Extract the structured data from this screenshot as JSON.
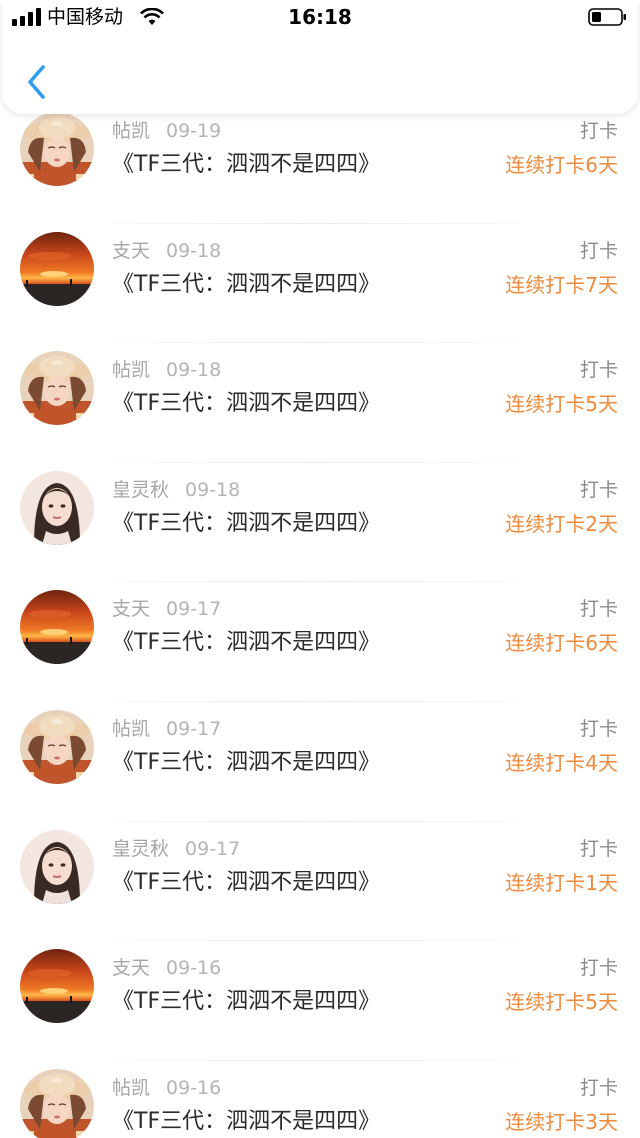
{
  "status_bar": {
    "carrier": "中国移动",
    "time": "16:18"
  },
  "nav": {
    "back_icon": "chevron-left-icon",
    "accent_color": "#2f9df0"
  },
  "colors": {
    "streak": "#f08a3c",
    "meta": "#a6a6a6"
  },
  "items": [
    {
      "user": "帖凯",
      "date": "09-19",
      "book": "《TF三代：泗泗不是四四》",
      "action": "打卡",
      "streak": "连续打卡6天",
      "avatar": "hat-girl"
    },
    {
      "user": "支天",
      "date": "09-18",
      "book": "《TF三代：泗泗不是四四》",
      "action": "打卡",
      "streak": "连续打卡7天",
      "avatar": "sunset"
    },
    {
      "user": "帖凯",
      "date": "09-18",
      "book": "《TF三代：泗泗不是四四》",
      "action": "打卡",
      "streak": "连续打卡5天",
      "avatar": "hat-girl"
    },
    {
      "user": "皇灵秋",
      "date": "09-18",
      "book": "《TF三代：泗泗不是四四》",
      "action": "打卡",
      "streak": "连续打卡2天",
      "avatar": "portrait"
    },
    {
      "user": "支天",
      "date": "09-17",
      "book": "《TF三代：泗泗不是四四》",
      "action": "打卡",
      "streak": "连续打卡6天",
      "avatar": "sunset"
    },
    {
      "user": "帖凯",
      "date": "09-17",
      "book": "《TF三代：泗泗不是四四》",
      "action": "打卡",
      "streak": "连续打卡4天",
      "avatar": "hat-girl"
    },
    {
      "user": "皇灵秋",
      "date": "09-17",
      "book": "《TF三代：泗泗不是四四》",
      "action": "打卡",
      "streak": "连续打卡1天",
      "avatar": "portrait"
    },
    {
      "user": "支天",
      "date": "09-16",
      "book": "《TF三代：泗泗不是四四》",
      "action": "打卡",
      "streak": "连续打卡5天",
      "avatar": "sunset"
    },
    {
      "user": "帖凯",
      "date": "09-16",
      "book": "《TF三代：泗泗不是四四》",
      "action": "打卡",
      "streak": "连续打卡3天",
      "avatar": "hat-girl"
    }
  ]
}
